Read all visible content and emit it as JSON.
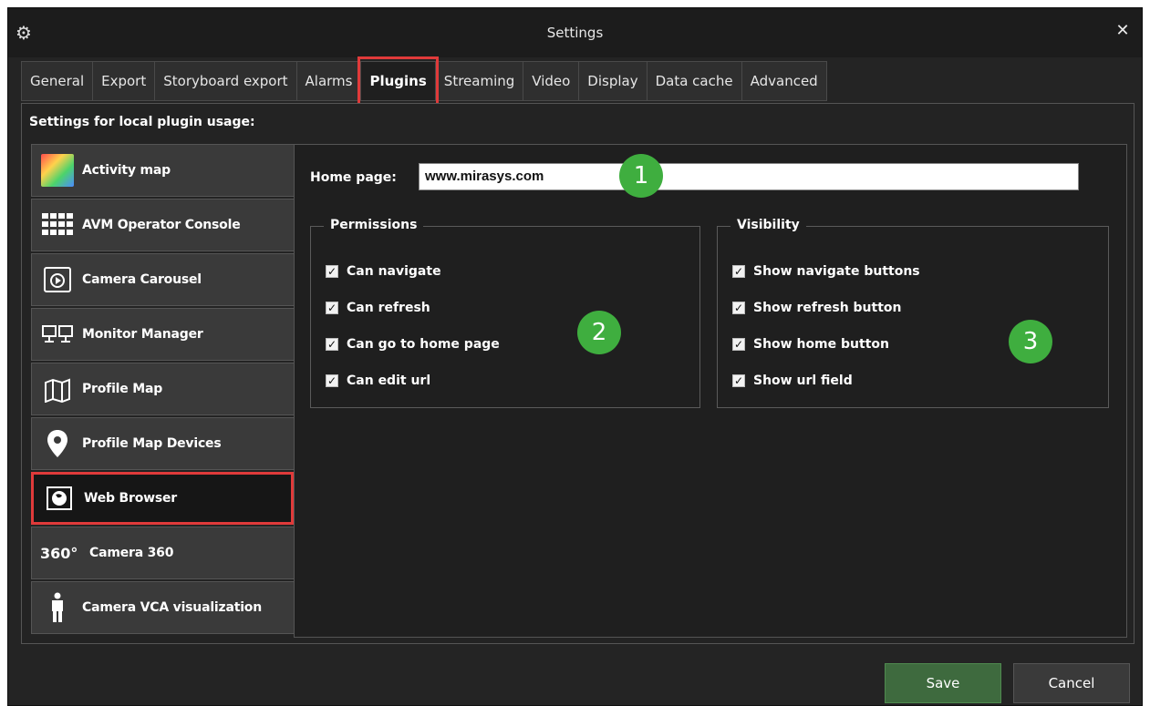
{
  "window": {
    "title": "Settings",
    "app_icon": "gears-icon",
    "close_icon": "close-icon"
  },
  "tabs": [
    {
      "label": "General"
    },
    {
      "label": "Export"
    },
    {
      "label": "Storyboard export"
    },
    {
      "label": "Alarms"
    },
    {
      "label": "Plugins",
      "active": true
    },
    {
      "label": "Streaming"
    },
    {
      "label": "Video"
    },
    {
      "label": "Display"
    },
    {
      "label": "Data cache"
    },
    {
      "label": "Advanced"
    }
  ],
  "panel": {
    "caption": "Settings for local plugin usage:"
  },
  "plugins": [
    {
      "label": "Activity map",
      "icon": "heatmap-icon"
    },
    {
      "label": "AVM Operator Console",
      "icon": "video-wall-icon"
    },
    {
      "label": "Camera Carousel",
      "icon": "carousel-icon"
    },
    {
      "label": "Monitor Manager",
      "icon": "monitors-icon"
    },
    {
      "label": "Profile Map",
      "icon": "map-icon"
    },
    {
      "label": "Profile Map Devices",
      "icon": "map-pin-icon"
    },
    {
      "label": "Web Browser",
      "icon": "globe-icon",
      "selected": true
    },
    {
      "label": "Camera 360",
      "icon": "360-icon",
      "icon_text": "360°"
    },
    {
      "label": "Camera VCA visualization",
      "icon": "person-icon"
    }
  ],
  "home_page": {
    "label": "Home page:",
    "value": "www.mirasys.com"
  },
  "permissions": {
    "legend": "Permissions",
    "items": [
      {
        "label": "Can navigate",
        "checked": true
      },
      {
        "label": "Can refresh",
        "checked": true
      },
      {
        "label": "Can go to home page",
        "checked": true
      },
      {
        "label": "Can edit url",
        "checked": true
      }
    ]
  },
  "visibility": {
    "legend": "Visibility",
    "items": [
      {
        "label": "Show navigate buttons",
        "checked": true
      },
      {
        "label": "Show refresh button",
        "checked": true
      },
      {
        "label": "Show home button",
        "checked": true
      },
      {
        "label": "Show url field",
        "checked": true
      }
    ]
  },
  "badges": [
    "1",
    "2",
    "3"
  ],
  "buttons": {
    "save": "Save",
    "cancel": "Cancel"
  },
  "colors": {
    "accent_green": "#3fae3f",
    "highlight_red": "#e03a3a",
    "save_green": "#3e6a3e"
  }
}
